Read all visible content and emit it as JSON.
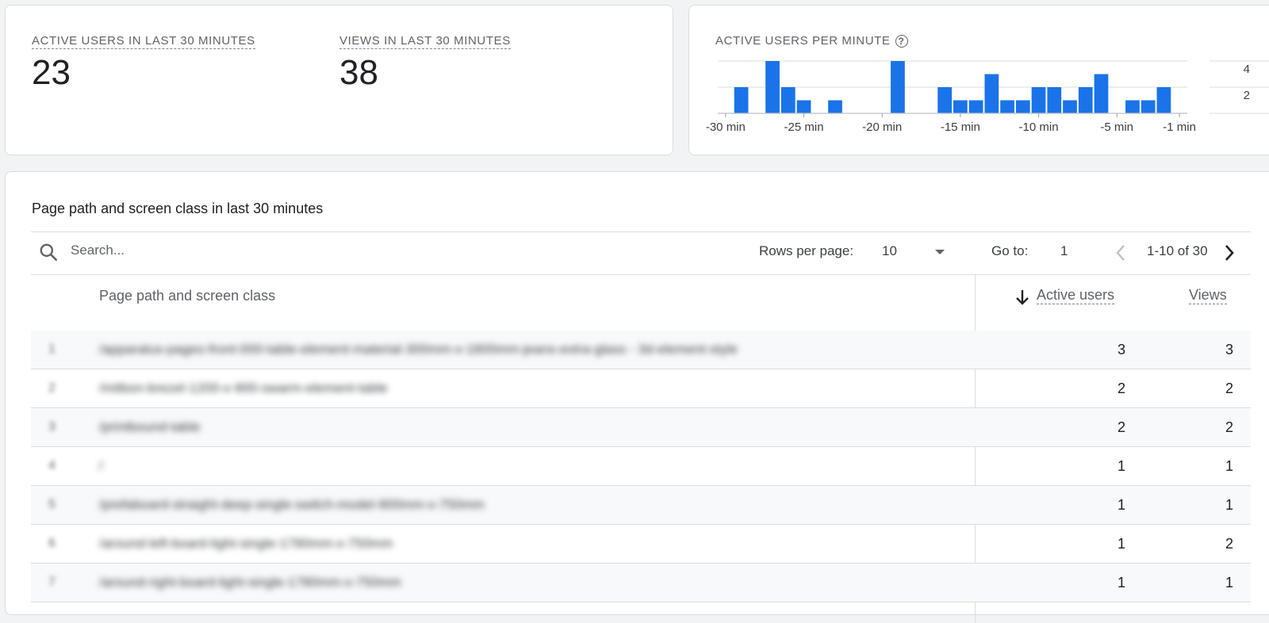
{
  "metrics": {
    "active_users": {
      "label": "ACTIVE USERS IN LAST 30 MINUTES",
      "value": "23"
    },
    "views": {
      "label": "VIEWS IN LAST 30 MINUTES",
      "value": "38"
    }
  },
  "chart_data": {
    "type": "bar",
    "title": "ACTIVE USERS PER MINUTE",
    "xlabel": "",
    "ylabel": "",
    "ylim": [
      0,
      4
    ],
    "y_ticks": [
      "4",
      "2"
    ],
    "x_tick_labels": [
      "-30 min",
      "-25 min",
      "-20 min",
      "-15 min",
      "-10 min",
      "-5 min",
      "-1 min"
    ],
    "x_tick_minutes": [
      -30,
      -25,
      -20,
      -15,
      -10,
      -5,
      -1
    ],
    "x": [
      -30,
      -29,
      -28,
      -27,
      -26,
      -25,
      -24,
      -23,
      -22,
      -21,
      -20,
      -19,
      -18,
      -17,
      -16,
      -15,
      -14,
      -13,
      -12,
      -11,
      -10,
      -9,
      -8,
      -7,
      -6,
      -5,
      -4,
      -3,
      -2,
      -1
    ],
    "values": [
      0,
      2,
      0,
      4,
      2,
      1,
      0,
      1,
      0,
      0,
      0,
      4,
      0,
      0,
      2,
      1,
      1,
      3,
      1,
      1,
      2,
      2,
      1,
      2,
      3,
      0,
      1,
      1,
      2,
      0
    ],
    "bar_color": "#1a73e8",
    "grid": true
  },
  "table": {
    "title": "Page path and screen class in last 30 minutes",
    "search_placeholder": "Search...",
    "rows_per_page_label": "Rows per page:",
    "rows_per_page_value": "10",
    "goto_label": "Go to:",
    "goto_value": "1",
    "pagination_text": "1-10 of 30",
    "columns": {
      "path": "Page path and screen class",
      "active_users": "Active users",
      "views": "Views"
    },
    "rows": [
      {
        "index": "1",
        "path": "/apparatus-pages-front-000-table-element-material-300mm-x-1800mm-jeans-extra-glass - 3d-element-style",
        "active_users": "3",
        "views": "3"
      },
      {
        "index": "2",
        "path": "/mitbon-brezel-1200-x-900-swarm-element-table",
        "active_users": "2",
        "views": "2"
      },
      {
        "index": "3",
        "path": "/printbound-table",
        "active_users": "2",
        "views": "2"
      },
      {
        "index": "4",
        "path": "/",
        "active_users": "1",
        "views": "1"
      },
      {
        "index": "5",
        "path": "/prefaboard-straight-deep-single-switch-model-900mm-x-750mm",
        "active_users": "1",
        "views": "1"
      },
      {
        "index": "6",
        "path": "/around-left-board-light-single-1780mm-x-750mm",
        "active_users": "1",
        "views": "2"
      },
      {
        "index": "7",
        "path": "/around-right-board-light-single-1780mm-x-750mm",
        "active_users": "1",
        "views": "1"
      }
    ]
  }
}
